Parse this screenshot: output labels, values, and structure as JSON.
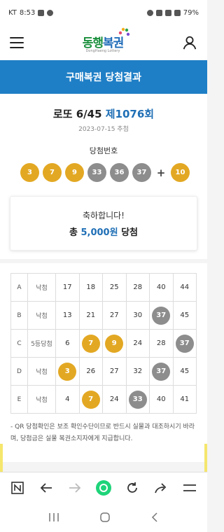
{
  "status": {
    "carrier": "KT",
    "time": "8:53",
    "battery": "79%"
  },
  "header": {
    "logo_main": "동행",
    "logo_blue": "복권",
    "logo_sub": "DongHaeng Lottery"
  },
  "title_bar": {
    "title": "구매복권 당첨결과"
  },
  "draw": {
    "game": "로또 6/45",
    "round": "제1076회",
    "date": "2023-07-15 추첨",
    "win_label": "당첨번호",
    "numbers": [
      "3",
      "7",
      "9",
      "33",
      "36",
      "37"
    ],
    "bonus": "10",
    "plus": "+"
  },
  "result_card": {
    "congrats": "축하합니다!",
    "prefix": "총",
    "amount": "5,000원",
    "suffix": "당첨"
  },
  "ticket": {
    "rows": [
      {
        "label": "A",
        "result": "낙첨",
        "numbers": [
          "17",
          "18",
          "25",
          "28",
          "40",
          "44"
        ],
        "marks": [
          "",
          "",
          "",
          "",
          "",
          ""
        ]
      },
      {
        "label": "B",
        "result": "낙첨",
        "numbers": [
          "13",
          "21",
          "27",
          "30",
          "37",
          "45"
        ],
        "marks": [
          "",
          "",
          "",
          "",
          "g",
          ""
        ]
      },
      {
        "label": "C",
        "result": "5등당첨",
        "numbers": [
          "6",
          "7",
          "9",
          "24",
          "28",
          "37"
        ],
        "marks": [
          "",
          "y",
          "y",
          "",
          "",
          "g"
        ]
      },
      {
        "label": "D",
        "result": "낙첨",
        "numbers": [
          "3",
          "26",
          "27",
          "32",
          "37",
          "45"
        ],
        "marks": [
          "y",
          "",
          "",
          "",
          "g",
          ""
        ]
      },
      {
        "label": "E",
        "result": "낙첨",
        "numbers": [
          "4",
          "7",
          "24",
          "33",
          "40",
          "41"
        ],
        "marks": [
          "",
          "y",
          "",
          "g",
          "",
          ""
        ]
      }
    ],
    "notice": "- QR 당첨확인은 보조 확인수단이므로 반드시 실물과 대조하시기 바라며, 당첨금은 실물 복권소지자에게 지급합니다."
  },
  "colors": {
    "primary": "#1f7fc6",
    "ball_yellow": "#e3a823",
    "ball_gray": "#8d8d8d",
    "logo_green": "#1a8f3c"
  },
  "browser": {
    "icons": [
      "n-tab-icon",
      "back-arrow-icon",
      "forward-arrow-icon",
      "home-dot-icon",
      "refresh-icon",
      "share-icon",
      "menu-icon"
    ]
  }
}
